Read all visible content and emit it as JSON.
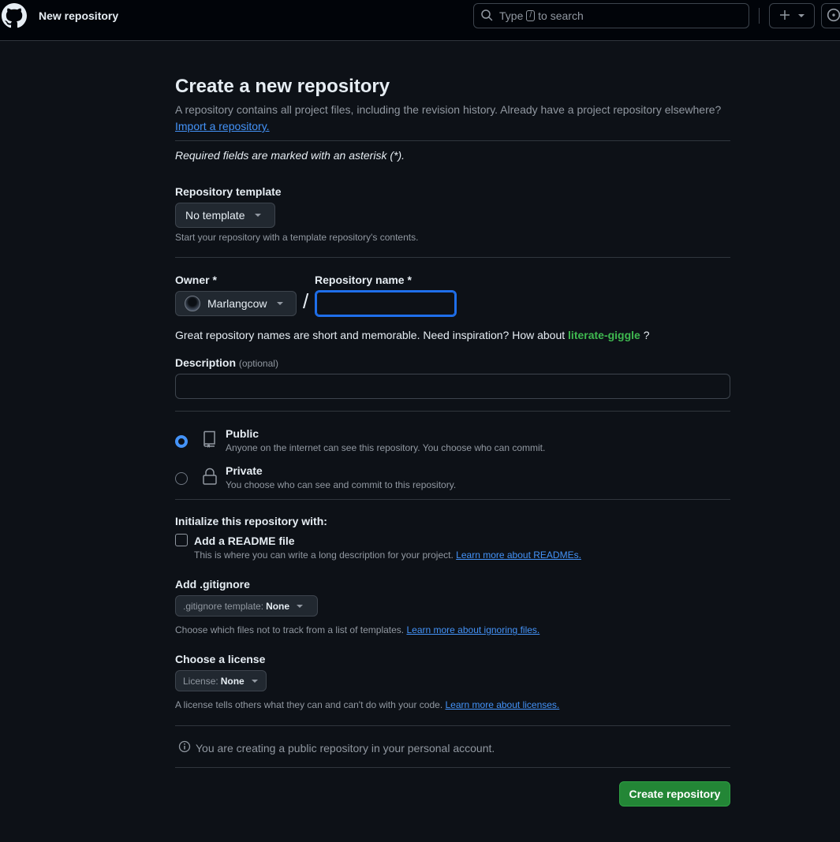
{
  "header": {
    "title": "New repository",
    "search": {
      "pre": "Type",
      "key": "/",
      "post": "to search"
    }
  },
  "page": {
    "title": "Create a new repository",
    "subtitle": "A repository contains all project files, including the revision history. Already have a project repository elsewhere?",
    "import_link": "Import a repository.",
    "required_note": "Required fields are marked with an asterisk (*)."
  },
  "template": {
    "label": "Repository template",
    "value": "No template",
    "hint": "Start your repository with a template repository's contents."
  },
  "owner": {
    "label": "Owner *",
    "value": "Marlangcow"
  },
  "separator": "/",
  "repo_name": {
    "label": "Repository name *",
    "value": ""
  },
  "suggestion": {
    "text": "Great repository names are short and memorable. Need inspiration? How about",
    "name": "literate-giggle",
    "suffix": "?"
  },
  "description": {
    "label": "Description",
    "optional": "(optional)",
    "value": ""
  },
  "visibility": {
    "selected": "Public",
    "options": [
      {
        "title": "Public",
        "desc": "Anyone on the internet can see this repository. You choose who can commit.",
        "icon": "repo-icon"
      },
      {
        "title": "Private",
        "desc": "You choose who can see and commit to this repository.",
        "icon": "lock-icon"
      }
    ]
  },
  "initialize": {
    "heading": "Initialize this repository with:",
    "readme": {
      "label": "Add a README file",
      "checked": false,
      "desc": "This is where you can write a long description for your project.",
      "link": "Learn more about READMEs."
    }
  },
  "gitignore": {
    "label": "Add .gitignore",
    "btn_prefix": ".gitignore template:",
    "btn_value": "None",
    "hint": "Choose which files not to track from a list of templates.",
    "link": "Learn more about ignoring files."
  },
  "license": {
    "label": "Choose a license",
    "btn_prefix": "License:",
    "btn_value": "None",
    "hint": "A license tells others what they can and can't do with your code.",
    "link": "Learn more about licenses."
  },
  "info": "You are creating a public repository in your personal account.",
  "submit_label": "Create repository",
  "colors": {
    "accent": "#4493f8",
    "primary_button": "#238636",
    "suggestion": "#3fb950",
    "background": "#0d1117"
  }
}
